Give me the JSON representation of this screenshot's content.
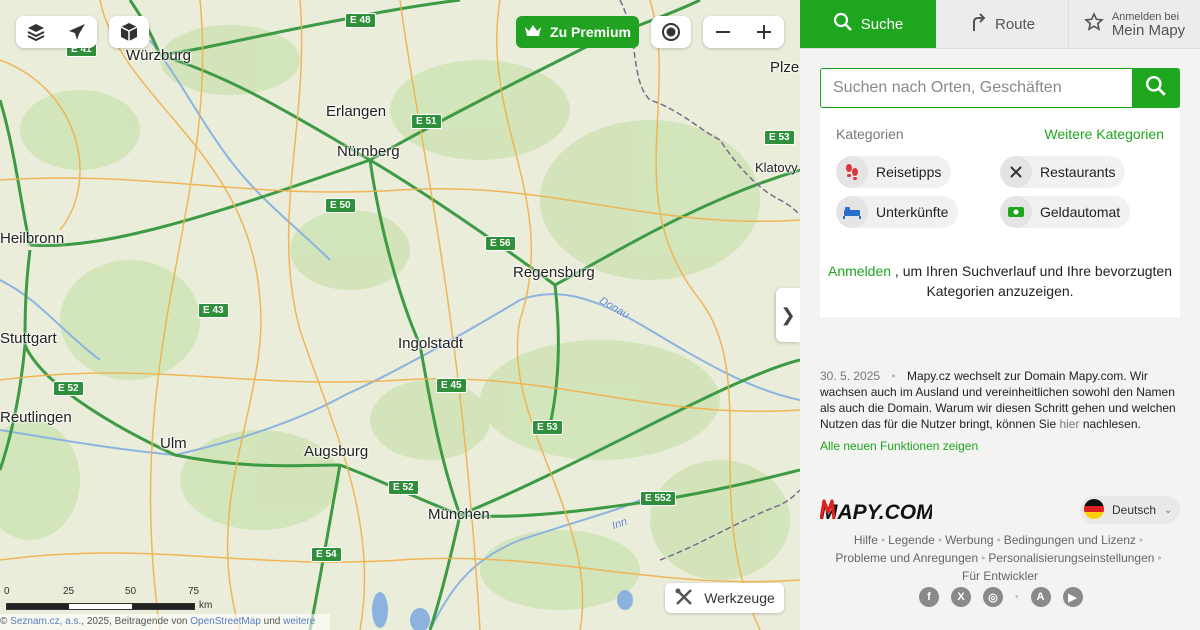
{
  "map": {
    "cities": [
      {
        "name": "Würzburg"
      },
      {
        "name": "Erlangen"
      },
      {
        "name": "Nürnberg"
      },
      {
        "name": "Heilbronn"
      },
      {
        "name": "Regensburg"
      },
      {
        "name": "Stuttgart"
      },
      {
        "name": "Ingolstadt"
      },
      {
        "name": "Reutlingen"
      },
      {
        "name": "Ulm"
      },
      {
        "name": "Augsburg"
      },
      {
        "name": "München"
      },
      {
        "name": "Klatovy"
      },
      {
        "name": "Plze"
      }
    ],
    "roads": [
      "E 48",
      "E 41",
      "E 51",
      "E 53",
      "E 50",
      "E 56",
      "E 43",
      "E 45",
      "E 52",
      "E 53",
      "E 52",
      "E 552",
      "E 54"
    ],
    "rivers": [
      "Donau",
      "Inn"
    ],
    "premium_label": "Zu Premium",
    "tools_label": "Werkzeuge",
    "scale": {
      "labels": [
        "0",
        "25",
        "50",
        "75"
      ],
      "unit": "km"
    },
    "attribution": {
      "prefix": "© ",
      "seznam": "Seznam.cz, a.s.",
      "mid": ", 2025, Beitragende von ",
      "osm": "OpenStreetMap",
      "und": " und ",
      "weitere": "weitere"
    },
    "icons": [
      "layers-icon",
      "plane-icon",
      "cube-icon",
      "crown-icon",
      "locate-icon",
      "zoom-out-icon",
      "zoom-in-icon",
      "chevron-right-icon",
      "tools-icon"
    ]
  },
  "panel": {
    "tabs": [
      {
        "label": "Suche",
        "icon": "search-icon",
        "active": true
      },
      {
        "label": "Route",
        "icon": "route-icon",
        "active": false
      },
      {
        "label_small": "Anmelden bei",
        "label": "Mein Mapy",
        "icon": "star-icon",
        "active": false
      }
    ],
    "search": {
      "placeholder": "Suchen nach Orten, Geschäften"
    },
    "categories": {
      "title": "Kategorien",
      "more": "Weitere Kategorien",
      "items": [
        {
          "label": "Reisetipps",
          "icon": "footprints-icon"
        },
        {
          "label": "Restaurants",
          "icon": "cutlery-icon"
        },
        {
          "label": "Unterkünfte",
          "icon": "bed-icon"
        },
        {
          "label": "Geldautomat",
          "icon": "atm-icon"
        }
      ]
    },
    "login": {
      "link": "Anmelden",
      "text": " , um Ihren Suchverlauf und Ihre bevorzugten Kategorien anzuzeigen."
    },
    "news": {
      "date": "30. 5. 2025",
      "text": "Mapy.cz wechselt zur Domain Mapy.com. Wir wachsen auch im Ausland und vereinheitlichen sowohl den Namen als auch die Domain. Warum wir diesen Schritt gehen und welchen Nutzen das für die Nutzer bringt, können Sie ",
      "link": "hier",
      "tail": " nachlesen.",
      "all": "Alle neuen Funktionen zeigen"
    },
    "footer": {
      "logo": "MAPY.COM",
      "language": "Deutsch",
      "links_row1": [
        "Hilfe",
        "Legende",
        "Werbung",
        "Bedingungen und Lizenz"
      ],
      "links_row2": [
        "Probleme und Anregungen",
        "Personalisierungseinstellungen"
      ],
      "links_row3": [
        "Für Entwickler"
      ],
      "social": [
        "facebook-icon",
        "x-icon",
        "instagram-icon",
        "app-store-icon",
        "google-play-icon"
      ]
    }
  },
  "colors": {
    "accent": "#1fa61f",
    "road_green": "#2f8f3b"
  }
}
